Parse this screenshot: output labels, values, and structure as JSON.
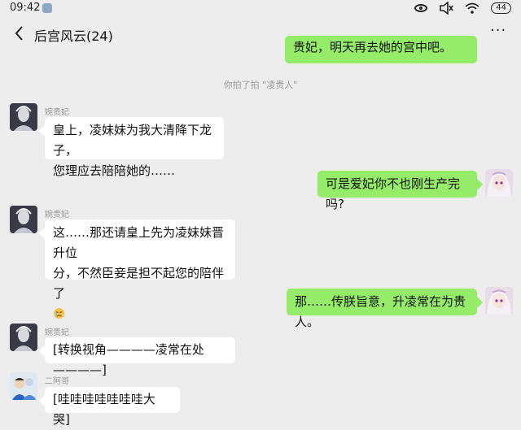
{
  "status_bar": {
    "time": "09:42",
    "battery": "44"
  },
  "header": {
    "title": "后宫风云(24)"
  },
  "system_notice": "你拍了拍 \"凌贵人\"",
  "messages": [
    {
      "side": "out",
      "text": "贵妃，明天再去她的宫中吧。"
    },
    {
      "side": "in",
      "sender": "婉贵妃",
      "line1": "皇上，凌妹妹为我大清降下龙子，",
      "line2": "您理应去陪陪她的……"
    },
    {
      "side": "out",
      "text": "可是爱妃你不也刚生产完吗?"
    },
    {
      "side": "in",
      "sender": "婉贵妃",
      "line1": "这……那还请皇上先为凌妹妹晋升位",
      "line2": "分，不然臣妾是担不起您的陪伴了",
      "emoji": "sad-face-emoji"
    },
    {
      "side": "out",
      "text": "那……传朕旨意，升凌常在为贵人。"
    },
    {
      "side": "in",
      "sender": "婉贵妃",
      "text": "[转换视角————凌常在处————]"
    },
    {
      "side": "in",
      "sender": "二阿哥",
      "text": "[哇哇哇哇哇哇哇大哭]"
    }
  ],
  "colors": {
    "background": "#ededed",
    "bubble_out": "#95ec69",
    "bubble_in": "#ffffff"
  },
  "icons": [
    "back-icon",
    "more-icon",
    "eye-icon",
    "mute-icon",
    "wifi-icon"
  ]
}
